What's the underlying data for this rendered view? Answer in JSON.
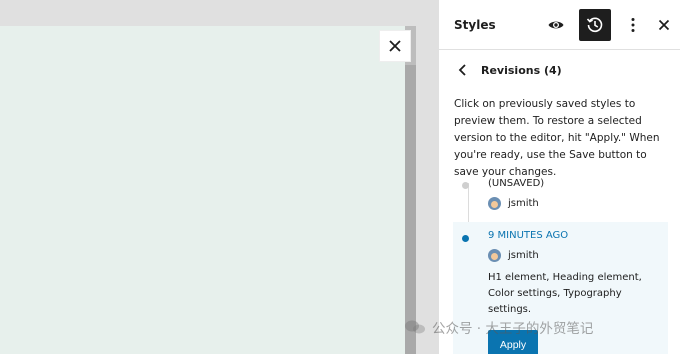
{
  "sidebar": {
    "title": "Styles",
    "revisions_title": "Revisions (4)",
    "description": "Click on previously saved styles to preview them. To restore a selected version to the editor, hit \"Apply.\" When you're ready, use the Save button to save your changes.",
    "revisions": [
      {
        "date": "(UNSAVED)",
        "user": "jsmith",
        "changes": "",
        "selected": false
      },
      {
        "date": "9 MINUTES AGO",
        "user": "jsmith",
        "changes": "H1 element, Heading element, Color settings, Typography settings.",
        "selected": true,
        "action_label": "Apply"
      }
    ]
  },
  "colors": {
    "accent": "#0a74b0",
    "canvas_bg": "#e7f0ec",
    "selected_bg": "#f1f8fb"
  },
  "icons": {
    "canvas_close": "close-icon",
    "header": [
      "eye-icon",
      "revisions-icon",
      "more-vertical-icon",
      "close-icon"
    ],
    "back": "chevron-left-icon"
  },
  "watermark": "公众号 · 大王子的外贸笔记"
}
